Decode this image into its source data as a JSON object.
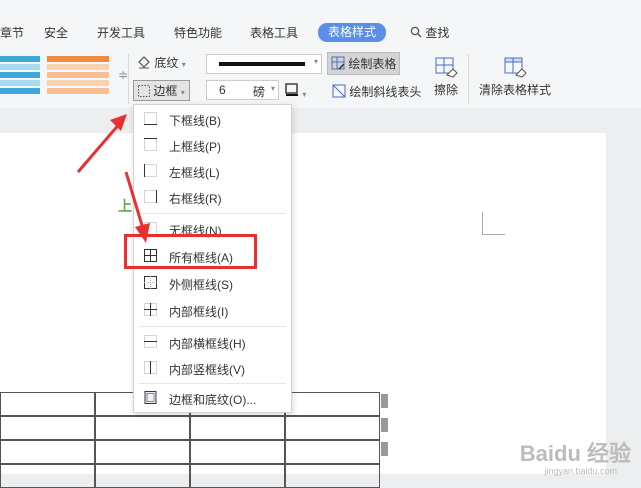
{
  "tabs": [
    "章节",
    "安全",
    "开发工具",
    "特色功能",
    "表格工具",
    "表格样式"
  ],
  "search_label": "查找",
  "ribbon": {
    "shading_label": "底纹",
    "border_label": "边框",
    "pen_weight_value": "6",
    "pen_weight_unit": "磅",
    "draw_table_label": "绘制表格",
    "draw_diagonal_label": "绘制斜线表头",
    "eraser_label": "擦除",
    "clear_style_label": "清除表格样式"
  },
  "menu": [
    {
      "label": "下框线(B)",
      "icon": "bottom-border-icon"
    },
    {
      "label": "上框线(P)",
      "icon": "top-border-icon"
    },
    {
      "label": "左框线(L)",
      "icon": "left-border-icon"
    },
    {
      "label": "右框线(R)",
      "icon": "right-border-icon"
    },
    {
      "label": "无框线(N)",
      "icon": "no-border-icon"
    },
    {
      "label": "所有框线(A)",
      "icon": "all-borders-icon"
    },
    {
      "label": "外侧框线(S)",
      "icon": "outside-borders-icon"
    },
    {
      "label": "内部框线(I)",
      "icon": "inside-borders-icon"
    },
    {
      "label": "内部横框线(H)",
      "icon": "inside-horizontal-border-icon"
    },
    {
      "label": "内部竖框线(V)",
      "icon": "inside-vertical-border-icon"
    },
    {
      "label": "边框和底纹(O)...",
      "icon": "borders-and-shading-icon"
    }
  ],
  "watermark": {
    "main": "Baidu 经验",
    "sub": "jingyan.baidu.com"
  },
  "colors": {
    "accent": "#5b8ee6",
    "highlight": "#e8312f"
  }
}
